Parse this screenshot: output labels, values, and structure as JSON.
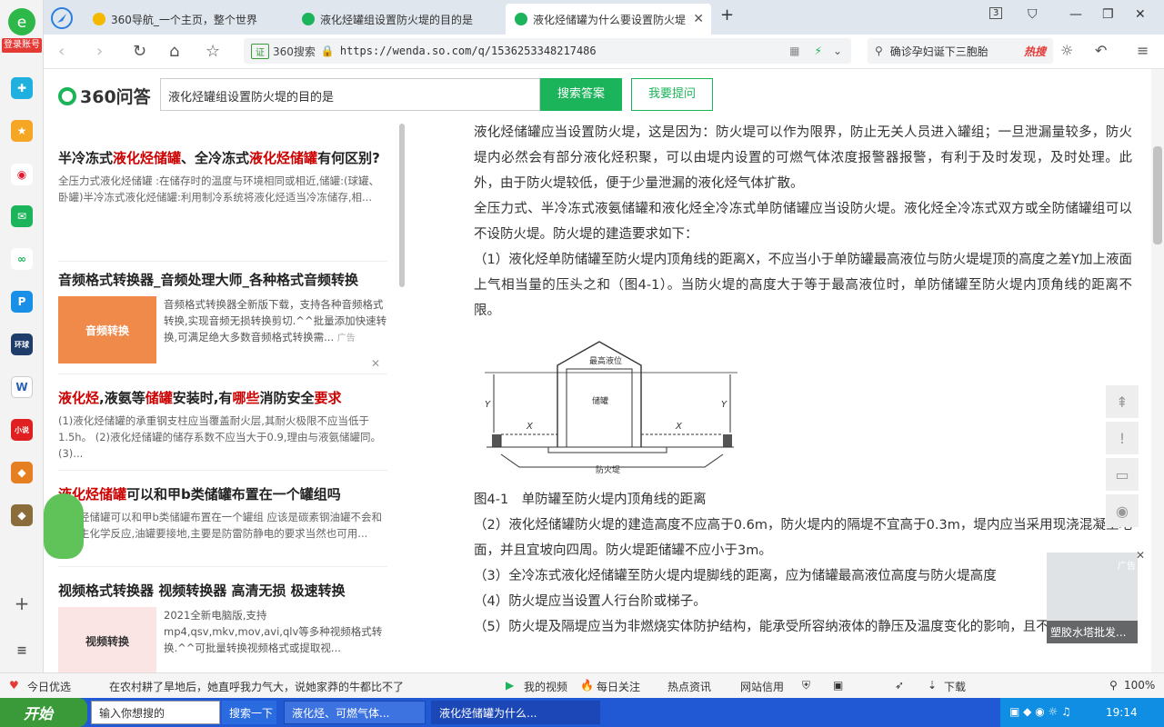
{
  "sidebar": {
    "login_label": "登录账号"
  },
  "tabs": [
    {
      "title": "360导航_一个主页，整个世界"
    },
    {
      "title": "液化烃罐组设置防火堤的目的是"
    },
    {
      "title": "液化烃储罐为什么要设置防火堤"
    }
  ],
  "tab_count": "3",
  "address": {
    "badge": "证",
    "site_label": "360搜索",
    "url": "https://wenda.so.com/q/1536253348217486"
  },
  "search_box": {
    "text": "确诊孕妇诞下三胞胎",
    "hot_label": "热搜"
  },
  "header": {
    "logo_text": "360问答",
    "query": "液化烃罐组设置防火堤的目的是",
    "search_button": "搜索答案",
    "ask_button": "我要提问"
  },
  "left": {
    "item1": {
      "t1": "半冷冻式",
      "r1": "液化烃储罐",
      "t2": "、全冷冻式",
      "r2": "液化烃储罐",
      "t3": "有何区别?",
      "snippet": "全压力式液化烃储罐 :在储存时的温度与环境相同或相近,储罐:(球罐、卧罐)半冷冻式液化烃储罐:利用制冷系统将液化烃适当冷冻储存,相..."
    },
    "ad1": {
      "title": "音频格式转换器_音频处理大师_各种格式音频转换",
      "img_label": "音频转换",
      "text": "音频格式转换器全新版下载，支持各种音频格式转换,实现音频无损转换剪切.^^批量添加快速转换,可满足绝大多数音频格式转换需...",
      "tag": "广告"
    },
    "item2": {
      "r1": "液化烃",
      "t1": ",液氨等",
      "r2": "储罐",
      "t2": "安装时,有",
      "r3": "哪些",
      "t3": "消防安全",
      "r4": "要求",
      "snippet": "(1)液化烃储罐的承重钢支柱应当覆盖耐火层,其耐火极限不应当低于1.5h。 (2)液化烃储罐的储存系数不应当大于0.9,理由与液氨储罐同。 (3)..."
    },
    "item3": {
      "r1": "液化烃储罐",
      "t1": "可以和甲b类储罐布置在一个罐组吗",
      "snippet": "液化烃储罐可以和甲b类储罐布置在一个罐组 应该是碳素钢油罐不会和油产生化学反应,油罐要接地,主要是防雷防静电的要求当然也可用..."
    },
    "ad2": {
      "title": "视频格式转换器 视频转换器 高清无损 极速转换",
      "img_label": "视频转换",
      "text": "2021全新电脑版,支持mp4,qsv,mkv,mov,avi,qlv等多种视频格式转换.^^可批量转换视频格式或提取视..."
    }
  },
  "article": {
    "p1": "液化烃储罐应当设置防火堤，这是因为：防火堤可以作为限界，防止无关人员进入罐组；一旦泄漏量较多，防火堤内必然会有部分液化烃积聚，可以由堤内设置的可燃气体浓度报警器报警，有利于及时发现，及时处理。此外，由于防火堤较低，便于少量泄漏的液化烃气体扩散。",
    "p2": "全压力式、半冷冻式液氨储罐和液化烃全冷冻式单防储罐应当设防火堤。液化烃全冷冻式双方或全防储罐组可以不设防火堤。防火堤的建造要求如下：",
    "p3": "（1）液化烃单防储罐至防火堤内顶角线的距离X，不应当小于单防罐最高液位与防火堤堤顶的高度之差Y加上液面上气相当量的压头之和（图4-1）。当防火堤的高度大于等于最高液位时，单防储罐至防火堤内顶角线的距离不限。",
    "figure": {
      "max_level": "最高液位",
      "tank": "储罐",
      "x_label": "X",
      "y_label": "Y",
      "dike": "防火堤"
    },
    "caption": "图4-1　单防罐至防火堤内顶角线的距离",
    "p4": "（2）液化烃储罐防火堤的建造高度不应高于0.6m，防火堤内的隔堤不宜高于0.3m，堤内应当采用现浇混凝土地面，并且宜坡向四周。防火堤距储罐不应小于3m。",
    "p5": "（3）全冷冻式液化烃储罐至防火堤内堤脚线的距离，应为储罐最高液位高度与防火堤高度",
    "p6": "（4）防火堤应当设置人行台阶或梯子。",
    "p7": "（5）防火堤及隔堤应当为非燃烧实体防护结构，能承受所容纳液体的静压及温度变化的影响，且不渗漏。"
  },
  "popup_ad": {
    "tag": "广告",
    "caption": "塑胶水塔批发..."
  },
  "statusbar": {
    "fav": "今日优选",
    "news": "在农村耕了旱地后，她直呼我力气大，说她家莽的牛都比不了",
    "video": "我的视频",
    "daily": "每日关注",
    "hot": "热点资讯",
    "credit": "网站信用",
    "download": "下载",
    "zoom": "100%"
  },
  "taskbar": {
    "start": "开始",
    "input": "输入你想搜的",
    "search": "搜索一下",
    "win1": "液化烃、可燃气体...",
    "win2": "液化烃储罐为什么...",
    "time": "19:14"
  }
}
